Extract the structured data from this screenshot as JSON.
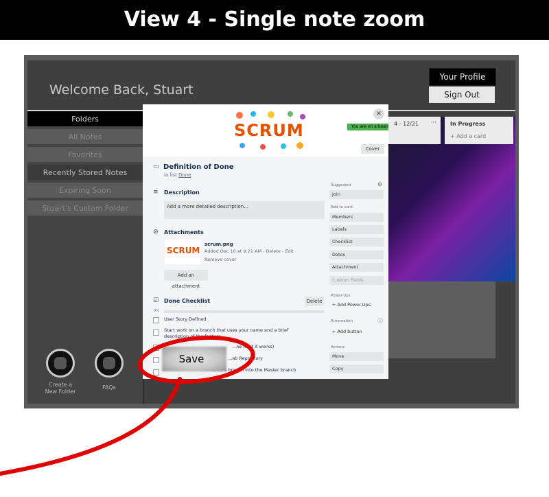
{
  "banner": {
    "title": "View 4 - Single note zoom"
  },
  "header": {
    "welcome": "Welcome Back, Stuart",
    "profile_label": "Your Profile",
    "signout_label": "Sign Out"
  },
  "sidebar": {
    "items": [
      {
        "label": "Folders"
      },
      {
        "label": "All Notes"
      },
      {
        "label": "Favorites"
      },
      {
        "label": "Recently Stored Notes"
      },
      {
        "label": "Expiring Soon"
      },
      {
        "label": "Stuart's Custom Folder"
      }
    ],
    "create_label_1": "Create a",
    "create_label_2": "New Folder",
    "faq_label": "FAQs"
  },
  "board": {
    "col1_title": "4 - 12/21",
    "col1_menu": "···",
    "col2_title": "In Progress",
    "col2_add": "+ Add a card"
  },
  "card": {
    "cover_image_text": "SCRUM",
    "cover_button": "Cover",
    "toast": "You are on a board",
    "close": "×",
    "title": "Definition of Done",
    "in_list_prefix": "in list",
    "in_list_name": "Done",
    "description_heading": "Description",
    "description_placeholder": "Add a more detailed description...",
    "attachments_heading": "Attachments",
    "attachment_thumb_text": "SCRUM",
    "attachment_name": "scrum.png",
    "attachment_meta": "Added Dec 10 at 9:21 AM - Delete - Edit",
    "attachment_remove": "Remove cover",
    "add_attachment": "Add an attachment",
    "checklist_heading": "Done Checklist",
    "checklist_delete": "Delete",
    "checklist_percent": "0%",
    "checklist_items": [
      {
        "text": "User Story Defined"
      },
      {
        "text": "Start work on a branch that uses your name and a brief description of the feature"
      },
      {
        "text": "...ne (and it works)"
      },
      {
        "text": "...ab Repository"
      },
      {
        "text": "...ur feature branch into the Master branch"
      }
    ],
    "side": {
      "suggested_label": "Suggested",
      "join": "Join",
      "add_to_card_label": "Add to card",
      "members": "Members",
      "labels": "Labels",
      "checklist": "Checklist",
      "dates": "Dates",
      "attachment": "Attachment",
      "custom_fields": "Custom Fields",
      "powerups_label": "Power-Ups",
      "add_powerups": "+ Add Power-Ups",
      "automation_label": "Automation",
      "add_button": "+ Add button",
      "actions_label": "Actions",
      "move": "Move",
      "copy": "Copy"
    }
  },
  "annotation": {
    "save_label": "Save",
    "color": "#e00000"
  }
}
